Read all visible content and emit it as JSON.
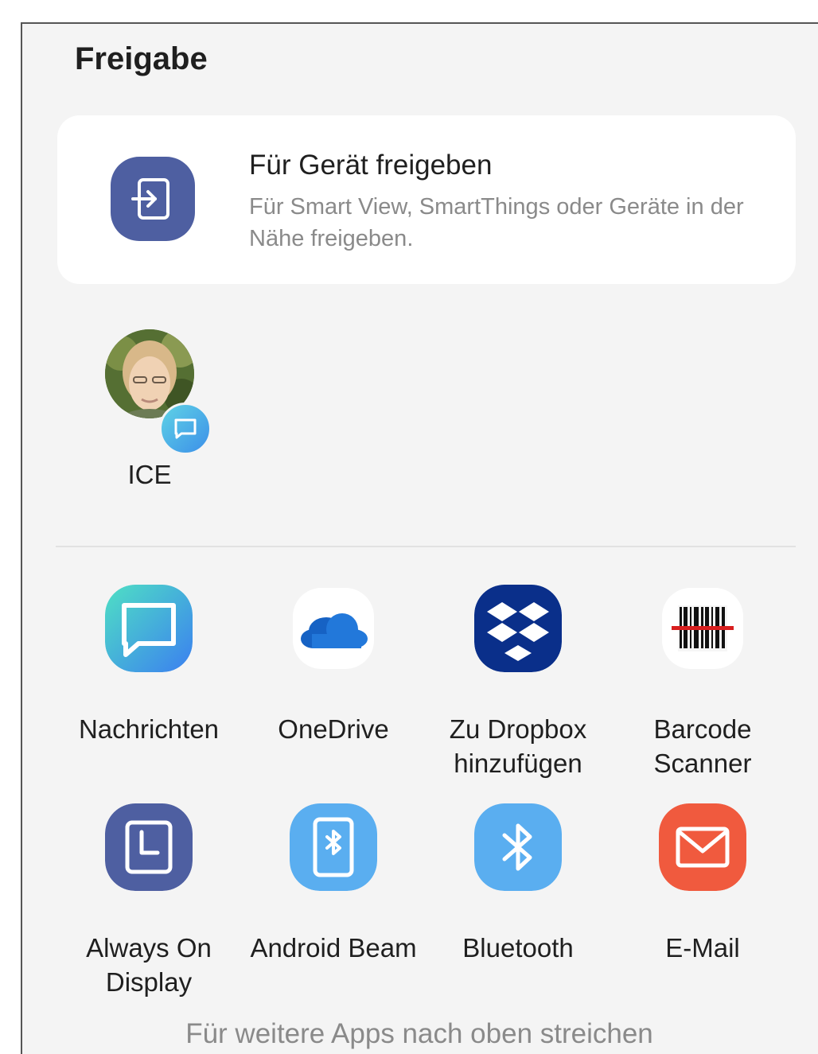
{
  "sheet": {
    "title": "Freigabe",
    "hint": "Für weitere Apps nach oben streichen"
  },
  "device_share": {
    "title": "Für Gerät freigeben",
    "description": "Für Smart View, SmartThings oder Geräte in der Nähe freigeben.",
    "icon": "share-to-device-icon"
  },
  "contacts": [
    {
      "label": "ICE",
      "badge_icon": "messages-badge-icon"
    }
  ],
  "apps": [
    {
      "label": "Nachrichten",
      "icon": "messages-icon"
    },
    {
      "label": "OneDrive",
      "icon": "onedrive-icon"
    },
    {
      "label": "Zu Dropbox hinzufügen",
      "icon": "dropbox-icon"
    },
    {
      "label": "Barcode Scanner",
      "icon": "barcode-scanner-icon"
    },
    {
      "label": "Always On Display",
      "icon": "always-on-display-icon"
    },
    {
      "label": "Android Beam",
      "icon": "android-beam-icon"
    },
    {
      "label": "Bluetooth",
      "icon": "bluetooth-icon"
    },
    {
      "label": "E-Mail",
      "icon": "email-icon"
    }
  ],
  "colors": {
    "sheet_background": "#f4f4f4",
    "card_background": "#ffffff",
    "device_icon": "#4e5fa1",
    "text_primary": "#1f1f1f",
    "text_secondary": "#8a8a8a"
  }
}
